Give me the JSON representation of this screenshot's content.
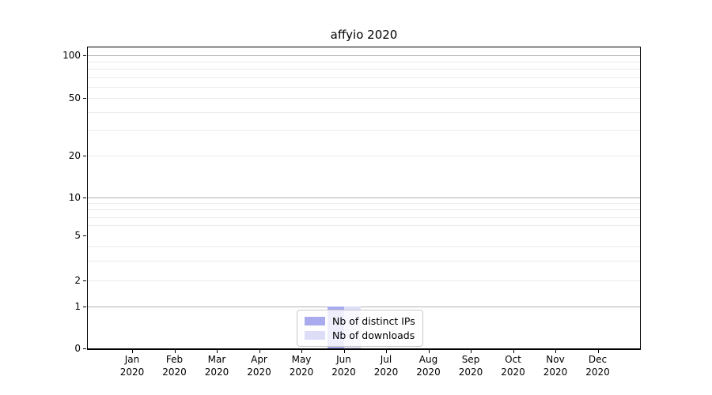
{
  "chart_data": {
    "type": "bar",
    "title": "affyio 2020",
    "categories": [
      "Jan",
      "Feb",
      "Mar",
      "Apr",
      "May",
      "Jun",
      "Jul",
      "Aug",
      "Sep",
      "Oct",
      "Nov",
      "Dec"
    ],
    "category_year": "2020",
    "series": [
      {
        "name": "Nb of distinct IPs",
        "color": "#aaaaee",
        "values": [
          0,
          0,
          0,
          0,
          0,
          1,
          0,
          0,
          0,
          0,
          0,
          0
        ]
      },
      {
        "name": "Nb of downloads",
        "color": "#ddddf8",
        "values": [
          0,
          0,
          0,
          0,
          0,
          1,
          0,
          0,
          0,
          0,
          0,
          0
        ]
      }
    ],
    "y_axis": {
      "ticks": [
        0,
        1,
        2,
        5,
        10,
        20,
        50,
        100
      ],
      "major_gridlines": [
        1,
        10,
        100
      ],
      "minor_gridlines": [
        2,
        3,
        4,
        6,
        7,
        8,
        9,
        20,
        30,
        40,
        50,
        60,
        70,
        80,
        90
      ],
      "range": [
        0,
        100
      ],
      "scale": "symlog"
    },
    "legend": {
      "position": "lower center",
      "entries": [
        "Nb of distinct IPs",
        "Nb of downloads"
      ]
    },
    "grid": true,
    "colors": {
      "major_grid": "#b0b0b0",
      "minor_grid": "#ebebeb",
      "axis": "#000000",
      "background": "#ffffff"
    }
  }
}
